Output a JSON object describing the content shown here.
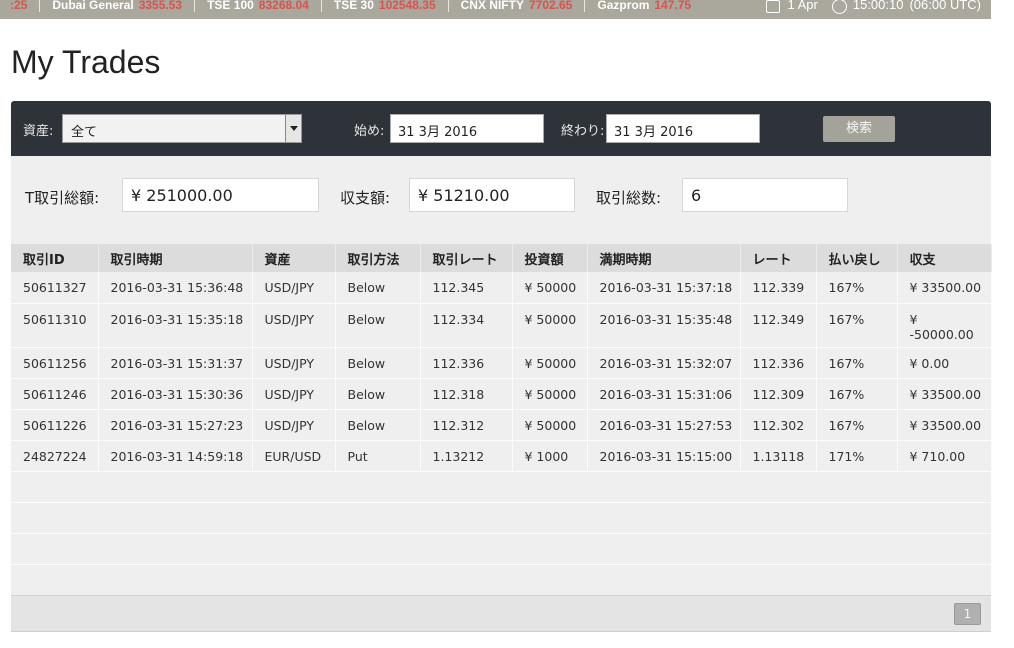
{
  "ticker": {
    "items": [
      {
        "name": "",
        "value": ":25"
      },
      {
        "name": "Dubai General",
        "value": "3355.53"
      },
      {
        "name": "TSE 100",
        "value": "83268.04"
      },
      {
        "name": "TSE 30",
        "value": "102548.35"
      },
      {
        "name": "CNX NIFTY",
        "value": "7702.65"
      },
      {
        "name": "Gazprom",
        "value": "147.75"
      }
    ],
    "date": "1 Apr",
    "time": "15:00:10",
    "tz": "(06:00 UTC)"
  },
  "page": {
    "title": "My Trades"
  },
  "filter": {
    "asset_label": "資産:",
    "asset_value": "全て",
    "start_label": "始め:",
    "start_value": "31 3月 2016",
    "end_label": "終わり:",
    "end_value": "31 3月 2016",
    "search_label": "検索"
  },
  "summary": {
    "total_label": "T取引総額:",
    "total_value": "¥ 251000.00",
    "pl_label": "収支額:",
    "pl_value": "¥ 51210.00",
    "count_label": "取引総数:",
    "count_value": "6"
  },
  "table": {
    "headers": [
      "取引ID",
      "取引時期",
      "資産",
      "取引方法",
      "取引レート",
      "投資額",
      "満期時期",
      "レート",
      "払い戻し",
      "収支"
    ],
    "rows": [
      [
        "50611327",
        "2016-03-31 15:36:48",
        "USD/JPY",
        "Below",
        "112.345",
        "¥ 50000",
        "2016-03-31 15:37:18",
        "112.339",
        "167%",
        "¥ 33500.00"
      ],
      [
        "50611310",
        "2016-03-31 15:35:18",
        "USD/JPY",
        "Below",
        "112.334",
        "¥ 50000",
        "2016-03-31 15:35:48",
        "112.349",
        "167%",
        "¥ -50000.00"
      ],
      [
        "50611256",
        "2016-03-31 15:31:37",
        "USD/JPY",
        "Below",
        "112.336",
        "¥ 50000",
        "2016-03-31 15:32:07",
        "112.336",
        "167%",
        "¥ 0.00"
      ],
      [
        "50611246",
        "2016-03-31 15:30:36",
        "USD/JPY",
        "Below",
        "112.318",
        "¥ 50000",
        "2016-03-31 15:31:06",
        "112.309",
        "167%",
        "¥ 33500.00"
      ],
      [
        "50611226",
        "2016-03-31 15:27:23",
        "USD/JPY",
        "Below",
        "112.312",
        "¥ 50000",
        "2016-03-31 15:27:53",
        "112.302",
        "167%",
        "¥ 33500.00"
      ],
      [
        "24827224",
        "2016-03-31 14:59:18",
        "EUR/USD",
        "Put",
        "1.13212",
        "¥ 1000",
        "2016-03-31 15:15:00",
        "1.13118",
        "171%",
        "¥ 710.00"
      ]
    ]
  },
  "pagination": {
    "current_page": "1"
  }
}
